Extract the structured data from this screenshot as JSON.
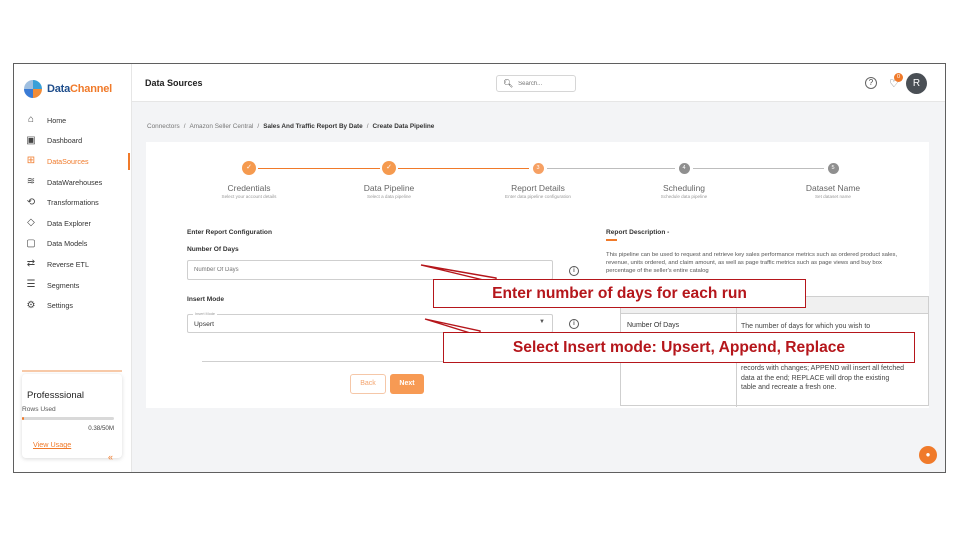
{
  "brand": {
    "part1": "Data",
    "part2": "Channel"
  },
  "sidebar": {
    "items": [
      {
        "label": "Home",
        "icon": "home-icon"
      },
      {
        "label": "Dashboard",
        "icon": "dashboard-icon"
      },
      {
        "label": "DataSources",
        "icon": "datasources-icon"
      },
      {
        "label": "DataWarehouses",
        "icon": "datawarehouses-icon"
      },
      {
        "label": "Transformations",
        "icon": "transformations-icon"
      },
      {
        "label": "Data Explorer",
        "icon": "data-explorer-icon"
      },
      {
        "label": "Data Models",
        "icon": "data-models-icon"
      },
      {
        "label": "Reverse ETL",
        "icon": "reverse-etl-icon"
      },
      {
        "label": "Segments",
        "icon": "segments-icon"
      },
      {
        "label": "Settings",
        "icon": "settings-icon"
      }
    ],
    "active_index": 2
  },
  "plan": {
    "title": "Professsional",
    "rows_label": "Rows Used",
    "used": "0.38/50M",
    "usage_fraction": 0.0076,
    "link": "View Usage"
  },
  "header": {
    "title": "Data Sources",
    "search_placeholder": "Search...",
    "notification_count": "0",
    "avatar_initial": "R"
  },
  "breadcrumb": {
    "items": [
      "Connectors",
      "Amazon Seller Central",
      "Sales And Traffic Report By Date",
      "Create Data Pipeline"
    ],
    "sep": "/"
  },
  "stepper": {
    "steps": [
      {
        "title": "Credentials",
        "sub": "Select your account details",
        "state": "done",
        "num": "1"
      },
      {
        "title": "Data Pipeline",
        "sub": "Select a data pipeline",
        "state": "done",
        "num": "2"
      },
      {
        "title": "Report Details",
        "sub": "Enter data pipeline configuration",
        "state": "current",
        "num": "3"
      },
      {
        "title": "Scheduling",
        "sub": "Schedule data pipeline",
        "state": "todo",
        "num": "4"
      },
      {
        "title": "Dataset Name",
        "sub": "Set dataset name",
        "state": "todo",
        "num": "5"
      }
    ],
    "check": "✓"
  },
  "form": {
    "section_title": "Enter Report Configuration",
    "days_label": "Number Of Days",
    "days_placeholder": "Number Of Days",
    "insert_label": "Insert Mode",
    "insert_legend": "Insert Mode",
    "insert_value": "Upsert",
    "back": "Back",
    "next": "Next"
  },
  "description": {
    "title": "Report Description -",
    "text": "This pipeline can be used to request and retrieve key sales performance metrics such as ordered product sales, revenue, units ordered, and claim amount, as well as page traffic metrics such as page views and buy box percentage of the seller's entire catalog",
    "param_name": "Number Of Days",
    "param_desc_top": "The number of days for which you wish to",
    "param_desc_bottom": "records with changes; APPEND will insert all fetched data at the end; REPLACE will drop the existing table and recreate a fresh one."
  },
  "callouts": {
    "days": "Enter number of days for each run",
    "insert": "Select Insert mode: Upsert, Append, Replace",
    "color": "#b5161b"
  },
  "colors": {
    "accent": "#f07a2a"
  }
}
